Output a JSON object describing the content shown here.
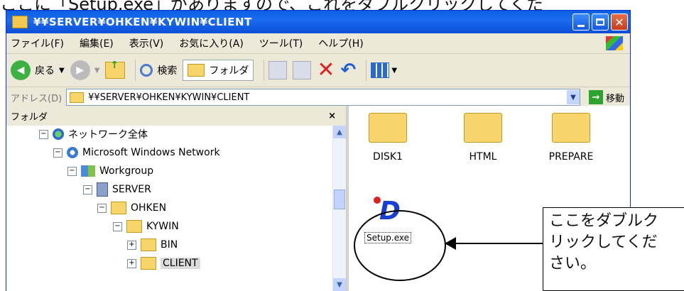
{
  "doc_text": "ここに「Setup.exe」がありますので、これをダブルクリックしてくだ",
  "window": {
    "title": "¥¥SERVER¥OHKEN¥KYWIN¥CLIENT"
  },
  "menubar": {
    "items": [
      "ファイル(F)",
      "編集(E)",
      "表示(V)",
      "お気に入り(A)",
      "ツール(T)",
      "ヘルプ(H)"
    ]
  },
  "toolbar": {
    "back_label": "戻る",
    "search_label": "検索",
    "folders_label": "フォルダ"
  },
  "address": {
    "label": "アドレス(D)",
    "value": "¥¥SERVER¥OHKEN¥KYWIN¥CLIENT",
    "go_label": "移動"
  },
  "folder_pane": {
    "header": "フォルダ",
    "close": "×",
    "tree": [
      {
        "label": "ネットワーク全体",
        "icon": "globe-icon"
      },
      {
        "label": "Microsoft Windows Network",
        "icon": "network-icon"
      },
      {
        "label": "Workgroup",
        "icon": "workgroup-icon"
      },
      {
        "label": "SERVER",
        "icon": "computer-icon"
      },
      {
        "label": "OHKEN",
        "icon": "share-icon"
      },
      {
        "label": "KYWIN",
        "icon": "folder-icon"
      },
      {
        "label": "BIN",
        "icon": "folder-icon"
      },
      {
        "label": "CLIENT",
        "icon": "folder-open-icon"
      }
    ]
  },
  "files": [
    {
      "label": "DISK1",
      "icon": "folder-icon"
    },
    {
      "label": "HTML",
      "icon": "folder-icon"
    },
    {
      "label": "PREPARE",
      "icon": "folder-icon"
    },
    {
      "label": "Setup.exe",
      "icon": "setup-app-icon"
    }
  ],
  "callout": {
    "text_line1": "ここをダブルク",
    "text_line2": "リックしてくだ",
    "text_line3": "さい。"
  },
  "colors": {
    "titlebar": "#0a5fe0",
    "folder": "#f7d56a",
    "go_button": "#2ea12e",
    "delete_x": "#e02020"
  }
}
